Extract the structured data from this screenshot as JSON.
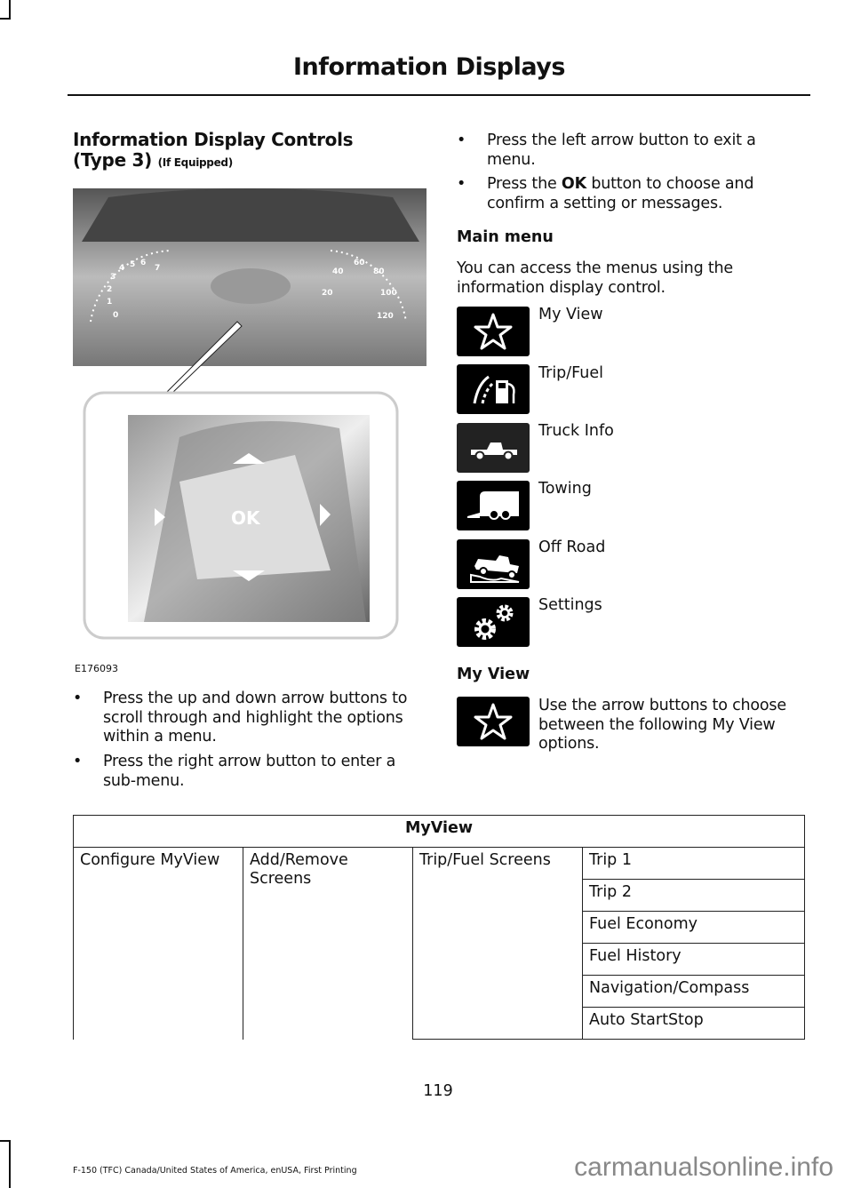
{
  "header": {
    "title": "Information Displays"
  },
  "section": {
    "title": "Information Display Controls (Type 3)",
    "title_line1": "Information Display Controls",
    "title_line2": "(Type 3)",
    "qualifier": "(If Equipped)"
  },
  "figure": {
    "id": "E176093",
    "ok_label": "OK",
    "gauge_left": [
      "0",
      "1",
      "2",
      "3",
      "4",
      "5",
      "6",
      "7"
    ],
    "gauge_right": [
      "20",
      "40",
      "60",
      "80",
      "100",
      "120"
    ]
  },
  "left_bullets": [
    "Press the up and down arrow buttons to scroll through and highlight the options within a menu.",
    "Press the right arrow button to enter a sub-menu."
  ],
  "right_bullets": [
    {
      "text": "Press the left arrow button to exit a menu."
    },
    {
      "pre": "Press the ",
      "bold": "OK",
      "post": " button to choose and confirm a setting or messages."
    }
  ],
  "main_menu": {
    "title": "Main menu",
    "intro": "You can access the menus using the information display control.",
    "items": [
      {
        "label": "My View",
        "icon": "star-icon"
      },
      {
        "label": "Trip/Fuel",
        "icon": "fuel-pump-icon"
      },
      {
        "label": "Truck Info",
        "icon": "pickup-truck-icon"
      },
      {
        "label": "Towing",
        "icon": "trailer-icon"
      },
      {
        "label": "Off Road",
        "icon": "off-road-truck-icon"
      },
      {
        "label": "Settings",
        "icon": "gears-icon"
      }
    ]
  },
  "my_view": {
    "title": "My View",
    "text": "Use the arrow buttons to choose between the following My View options.",
    "icon": "star-icon"
  },
  "table": {
    "header": "MyView",
    "col1": "Configure MyView",
    "col2": "Add/Remove Screens",
    "col3": "Trip/Fuel Screens",
    "col4": [
      "Trip 1",
      "Trip 2",
      "Fuel Economy",
      "Fuel History",
      "Navigation/Compass",
      "Auto StartStop"
    ]
  },
  "page_number": "119",
  "footer": "F-150 (TFC) Canada/United States of America, enUSA, First Printing",
  "watermark": "carmanualsonline.info"
}
